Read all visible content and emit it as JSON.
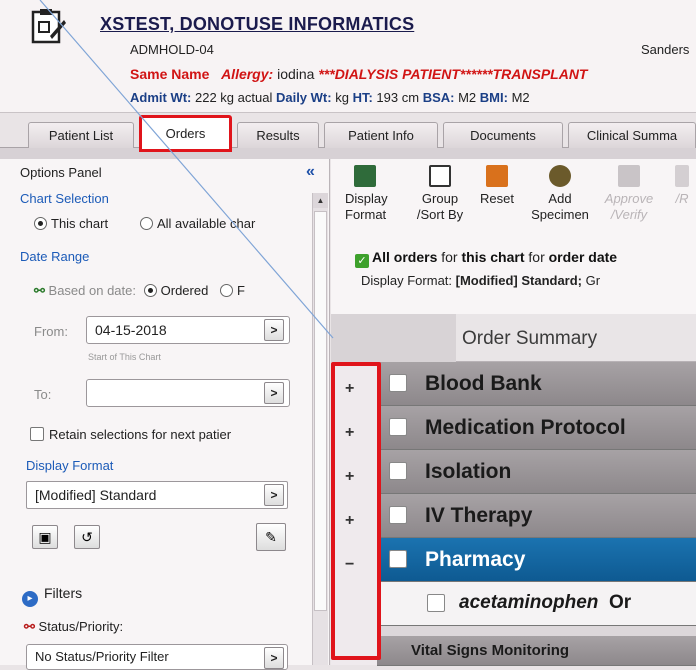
{
  "patient": {
    "name": "XSTEST, DONOTUSE INFORMATICS",
    "admhold": "ADMHOLD-04",
    "physician": "Sanders",
    "same_name": "Same Name",
    "allergy_label": "Allergy:",
    "allergy_value": "iodina",
    "flags": "***DIALYSIS PATIENT******TRANSPLANT",
    "vitals": {
      "admit_wt_label": "Admit Wt:",
      "admit_wt_value": "222 kg   actual",
      "daily_wt_label": "Daily Wt:",
      "daily_wt_value": "kg",
      "ht_label": "HT:",
      "ht_value": "193 cm",
      "bsa_label": "BSA:",
      "bsa_value": "M2",
      "bmi_label": "BMI:",
      "bmi_value": "M2"
    }
  },
  "tabs": [
    "Patient List",
    "Orders",
    "Results",
    "Patient Info",
    "Documents",
    "Clinical Summa"
  ],
  "options_panel": {
    "title": "Options Panel",
    "chart_selection": {
      "label": "Chart Selection",
      "this_chart": "This chart",
      "all_charts": "All available char"
    },
    "date_range": {
      "label": "Date Range",
      "based_on": "Based on date:",
      "ordered": "Ordered",
      "other": "F",
      "from_label": "From:",
      "from_value": "04-15-2018",
      "from_hint": "Start of This Chart",
      "to_label": "To:",
      "to_value": ""
    },
    "retain_label": "Retain selections for next patier",
    "display_format": {
      "label": "Display Format",
      "value": "[Modified] Standard"
    },
    "filters_label": "Filters",
    "status_priority_label": "Status/Priority:",
    "status_priority_value": "No Status/Priority Filter"
  },
  "toolbar": {
    "display_format": [
      "Display",
      "Format"
    ],
    "group_sort": [
      "Group",
      "/Sort By"
    ],
    "reset": [
      "Reset",
      ""
    ],
    "add_specimen": [
      "Add",
      "Specimen"
    ],
    "approve_verify": [
      "Approve",
      "/Verify"
    ],
    "more": [
      "",
      "/R"
    ]
  },
  "info": {
    "line1_a": "All orders",
    "line1_b": " for ",
    "line1_c": "this chart",
    "line1_d": " for ",
    "line1_e": "order date",
    "line2_a": "Display Format: ",
    "line2_b": "[Modified] Standard;",
    "line2_c": " Gr"
  },
  "grid": {
    "header": "Order Summary",
    "rows": [
      {
        "label": "Blood Bank",
        "expander": "+"
      },
      {
        "label": "Medication Protocol",
        "expander": "+"
      },
      {
        "label": "Isolation",
        "expander": "+"
      },
      {
        "label": "IV Therapy",
        "expander": "+"
      },
      {
        "label": "Pharmacy",
        "expander": "−"
      },
      {
        "label": "acetaminophen",
        "suffix": "Or"
      },
      {
        "label": "Vital Signs Monitoring",
        "expander": ""
      }
    ]
  },
  "colors": {
    "highlight_red": "#e0141b",
    "selected_row": "#1b73b0",
    "link_blue": "#1c5bb8"
  }
}
